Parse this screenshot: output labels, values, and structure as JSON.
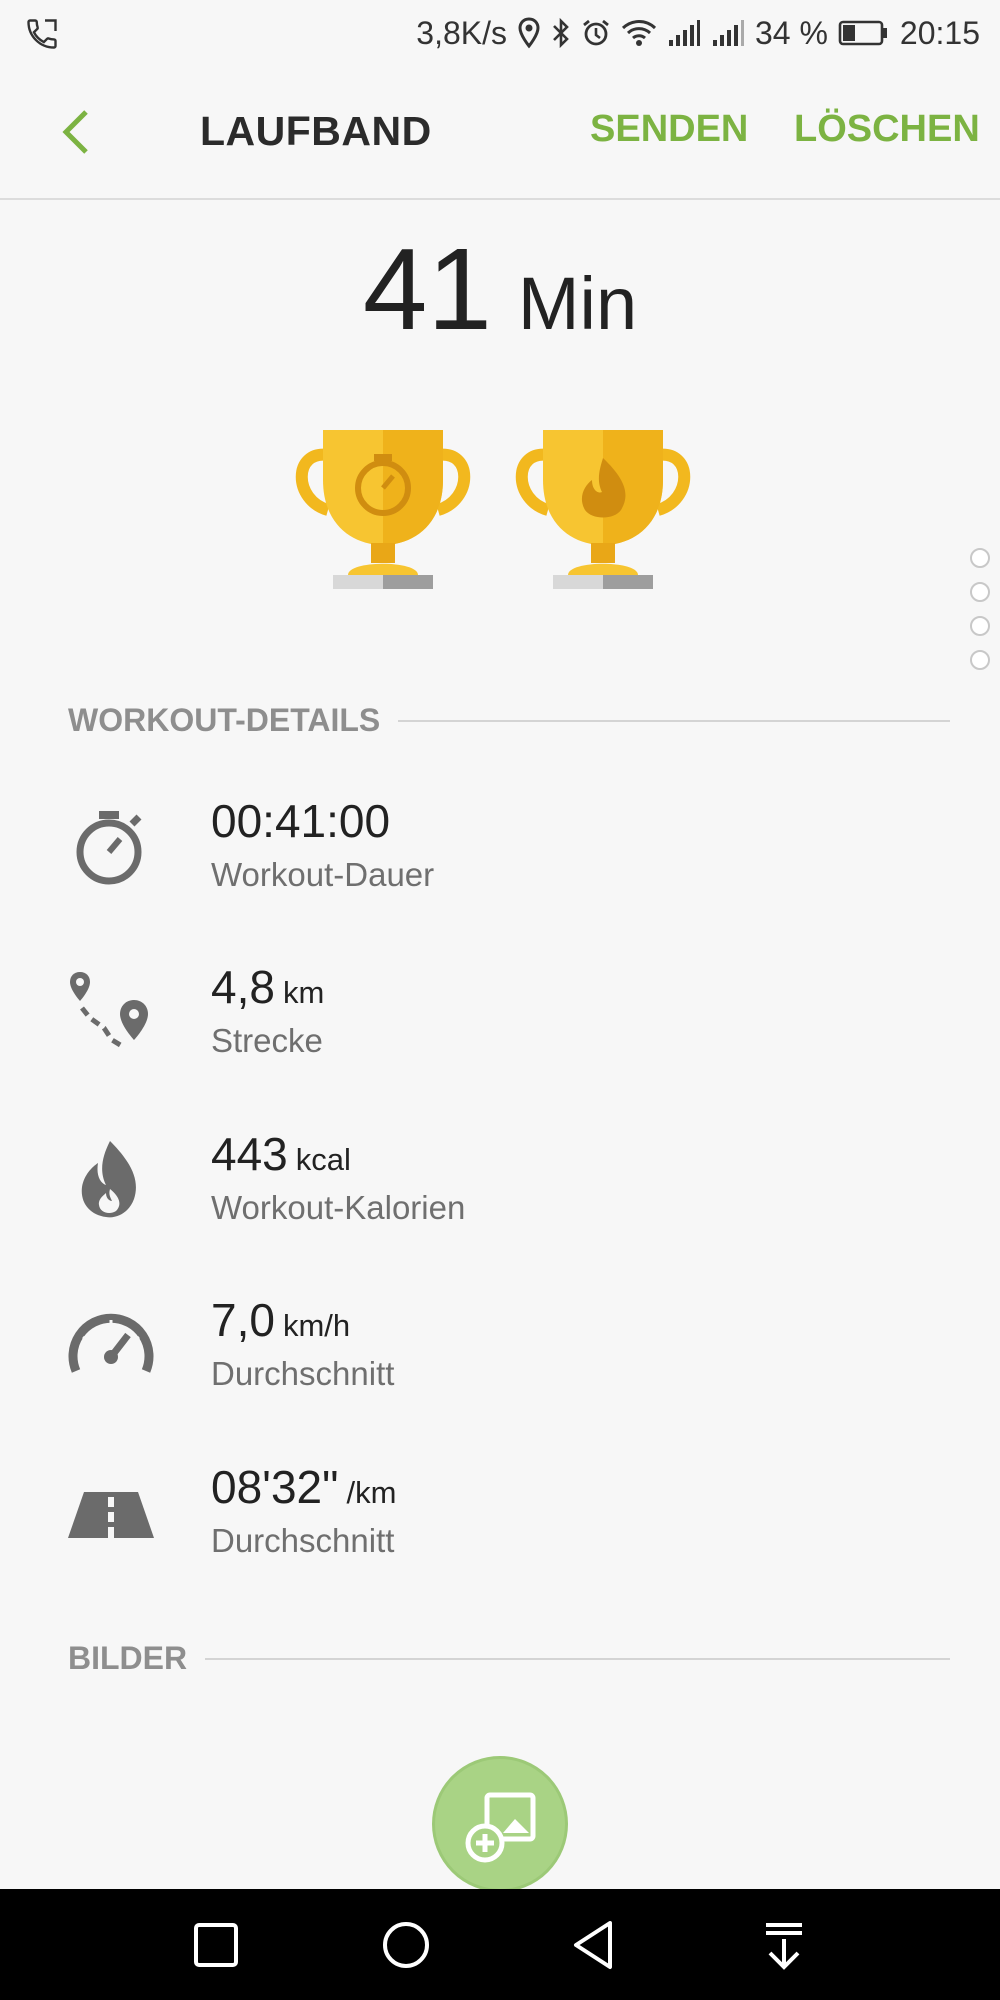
{
  "status_bar": {
    "speed": "3,8K/s",
    "battery_percent": "34 %",
    "battery_level": 0.34,
    "time": "20:15",
    "icons": [
      "phone-icon",
      "location-icon",
      "bluetooth-icon",
      "alarm-icon",
      "wifi-icon",
      "signal-icon",
      "signal-icon",
      "battery-icon"
    ]
  },
  "app_bar": {
    "title": "LAUFBAND",
    "send_label": "SENDEN",
    "delete_label": "LÖSCHEN",
    "accent_color": "#7cb342"
  },
  "summary": {
    "duration_value": "41",
    "duration_unit": "Min",
    "trophies": [
      "stopwatch-trophy",
      "flame-trophy"
    ]
  },
  "sections": {
    "details_header": "WORKOUT-DETAILS",
    "images_header": "BILDER"
  },
  "details": [
    {
      "icon": "stopwatch-icon",
      "value": "00:41:00",
      "unit": "",
      "label": "Workout-Dauer"
    },
    {
      "icon": "route-icon",
      "value": "4,8",
      "unit": "km",
      "label": "Strecke"
    },
    {
      "icon": "flame-icon",
      "value": "443",
      "unit": "kcal",
      "label": "Workout-Kalorien"
    },
    {
      "icon": "speedometer-icon",
      "value": "7,0",
      "unit": "km/h",
      "label": "Durchschnitt"
    },
    {
      "icon": "road-icon",
      "value": "08'32\"",
      "unit": "/km",
      "label": "Durchschnitt"
    }
  ],
  "fab": {
    "icon": "add-image-icon",
    "color": "#a9d385"
  },
  "nav_bar": {
    "icons": [
      "recent-apps-icon",
      "home-icon",
      "back-icon",
      "notification-pull-icon"
    ]
  }
}
